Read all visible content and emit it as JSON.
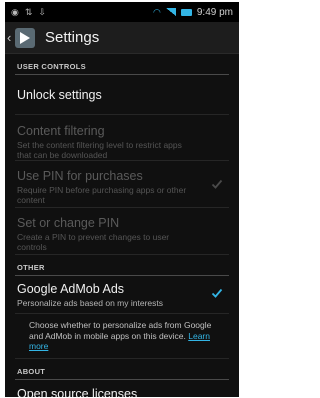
{
  "status_bar": {
    "left_icons": [
      "alert-icon",
      "usb-icon",
      "download-icon"
    ],
    "time": "9:49 pm"
  },
  "action_bar": {
    "title": "Settings"
  },
  "sections": {
    "user_controls": {
      "header": "USER CONTROLS",
      "unlock_settings": "Unlock settings",
      "content_filtering": {
        "title": "Content filtering",
        "summary": "Set the content filtering level to restrict apps that can be downloaded"
      },
      "use_pin": {
        "title": "Use PIN for purchases",
        "summary": "Require PIN before purchasing apps or other content",
        "checked": true
      },
      "change_pin": {
        "title": "Set or change PIN",
        "summary": "Create a PIN to prevent changes to user controls"
      }
    },
    "other": {
      "header": "OTHER",
      "admob": {
        "title": "Google AdMob Ads",
        "summary": "Personalize ads based on my interests",
        "checked": true
      },
      "info_text": "Choose whether to personalize ads from Google and AdMob in mobile apps on this device.",
      "learn_more": "Learn more"
    },
    "about": {
      "header": "ABOUT",
      "open_source": "Open source licenses"
    }
  },
  "colors": {
    "accent": "#33b5e5",
    "background": "#101010"
  }
}
